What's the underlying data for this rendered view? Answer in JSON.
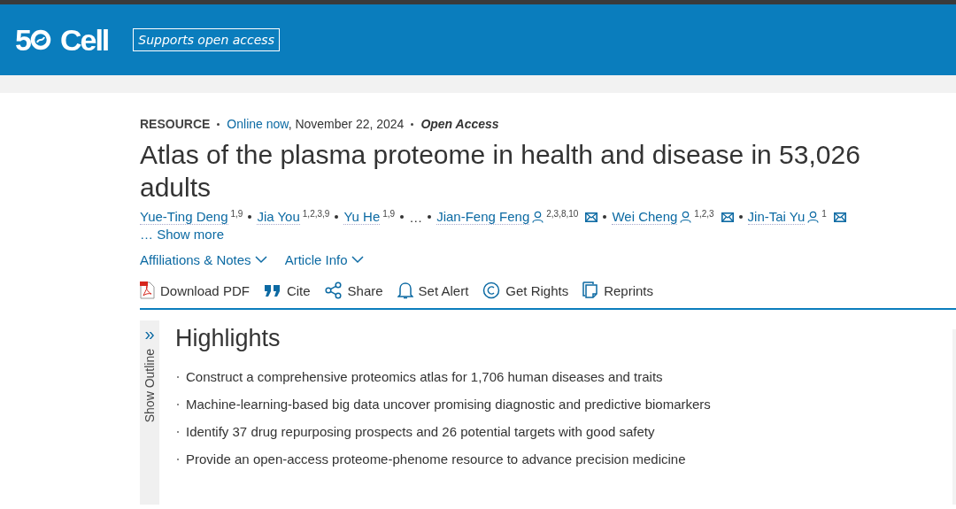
{
  "header": {
    "logo": {
      "digit": "5",
      "name": "Cell"
    },
    "badge": "Supports open access"
  },
  "meta": {
    "type": "RESOURCE",
    "online": "Online now",
    "date": ", November 22, 2024",
    "access": "Open Access"
  },
  "title": "Atlas of the plasma proteome in health and disease in 53,026 adults",
  "authors": [
    {
      "kind": "author",
      "name": "Yue-Ting Deng",
      "sup": "1,9",
      "corresponding": false
    },
    {
      "kind": "author",
      "name": "Jia You",
      "sup": "1,2,3,9",
      "corresponding": false
    },
    {
      "kind": "author",
      "name": "Yu He",
      "sup": "1,9",
      "corresponding": false
    },
    {
      "kind": "ellipsis",
      "name": "…"
    },
    {
      "kind": "author",
      "name": "Jian-Feng Feng",
      "sup": "2,3,8,10",
      "corresponding": true
    },
    {
      "kind": "author",
      "name": "Wei Cheng",
      "sup": "1,2,3",
      "corresponding": true
    },
    {
      "kind": "author",
      "name": "Jin-Tai Yu",
      "sup": "1",
      "corresponding": true
    }
  ],
  "show_more": "… Show more",
  "expanders": [
    "Affiliations & Notes",
    "Article Info"
  ],
  "tools": [
    {
      "kind": "pdf",
      "label": "Download PDF"
    },
    {
      "kind": "cite",
      "label": "Cite"
    },
    {
      "kind": "share",
      "label": "Share"
    },
    {
      "kind": "alert",
      "label": "Set Alert"
    },
    {
      "kind": "rights",
      "label": "Get Rights"
    },
    {
      "kind": "reprints",
      "label": "Reprints"
    }
  ],
  "outline": {
    "label": "Show Outline",
    "icon": "»"
  },
  "highlights": {
    "heading": "Highlights",
    "items": [
      "Construct a comprehensive proteomics atlas for 1,706 human diseases and traits",
      "Machine-learning-based big data uncover promising diagnostic and predictive biomarkers",
      "Identify 37 drug repurposing prospects and 26 potential targets with good safety",
      "Provide an open-access proteome-phenome resource to advance precision medicine"
    ]
  }
}
